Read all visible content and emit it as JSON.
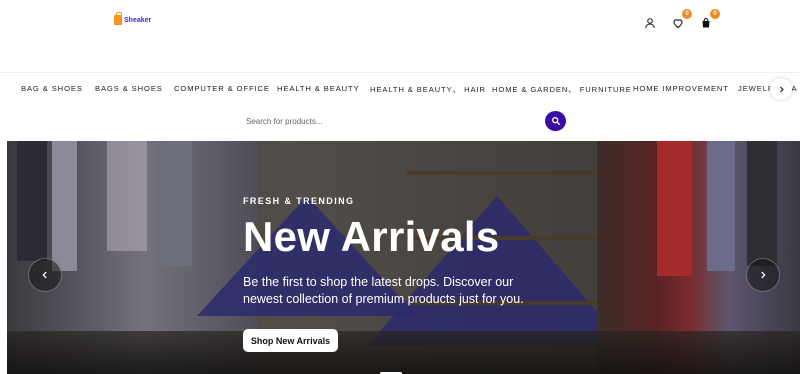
{
  "header": {
    "logo_text": "Sheaker",
    "wishlist_count": "0",
    "cart_count": "0"
  },
  "categories": [
    "BAG & SHOES",
    "BAGS & SHOES",
    "COMPUTER & OFFICE",
    "HEALTH & BEAUTY",
    "HEALTH & BEAUTY、 HAIR",
    "HOME & GARDEN、 FURNITURE",
    "HOME IMPROVEMENT",
    "JEWELRY & A"
  ],
  "search": {
    "placeholder": "Search for products..."
  },
  "hero": {
    "eyebrow": "FRESH & TRENDING",
    "title": "New Arrivals",
    "subtitle": "Be the first to shop the latest drops. Discover our newest collection of premium products just for you.",
    "cta_label": "Shop New Arrivals"
  },
  "colors": {
    "accent": "#3a0ca3",
    "badge": "#f08a24",
    "logo": "#3b2bd1"
  }
}
